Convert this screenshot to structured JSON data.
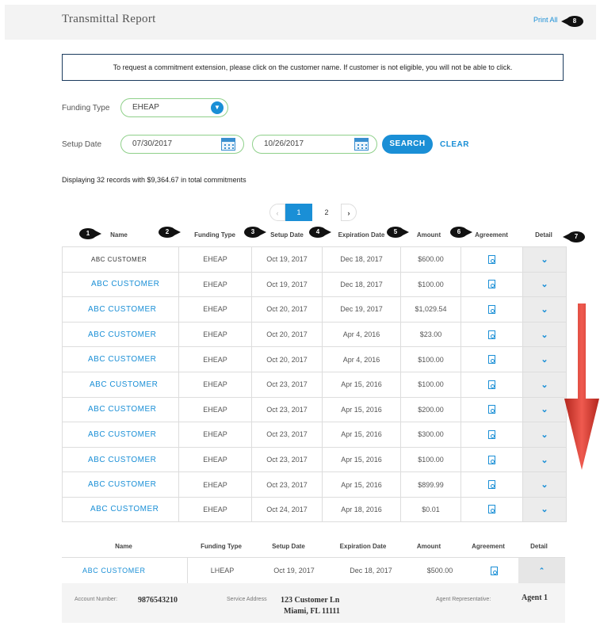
{
  "header": {
    "title": "Transmittal Report",
    "print_all": "Print All"
  },
  "callouts": {
    "c1": "1",
    "c2": "2",
    "c3": "3",
    "c4": "4",
    "c5": "5",
    "c6": "6",
    "c7": "7",
    "c8": "8"
  },
  "info_text": "To request a commitment extension, please click on the customer name. If customer is not eligible, you will not be able to click.",
  "filters": {
    "funding_type_label": "Funding Type",
    "funding_type_value": "EHEAP",
    "setup_date_label": "Setup Date",
    "start_date": "07/30/2017",
    "end_date": "10/26/2017",
    "search_label": "SEARCH",
    "clear_label": "CLEAR"
  },
  "records_text": "Displaying 32 records with $9,364.67 in total commitments",
  "pager": {
    "prev": "‹",
    "page1": "1",
    "page2": "2",
    "next": "›"
  },
  "columns": {
    "name": "Name",
    "funding": "Funding Type",
    "setup": "Setup Date",
    "expiration": "Expiration Date",
    "amount": "Amount",
    "agreement": "Agreement",
    "detail": "Detail"
  },
  "rows": [
    {
      "name": "ABC CUSTOMER",
      "funding": "EHEAP",
      "setup": "Oct 19, 2017",
      "expiration": "Dec 18, 2017",
      "amount": "$600.00"
    },
    {
      "name": "ABC CUSTOMER",
      "funding": "EHEAP",
      "setup": "Oct 19, 2017",
      "expiration": "Dec 18, 2017",
      "amount": "$100.00"
    },
    {
      "name": "ABC CUSTOMER",
      "funding": "EHEAP",
      "setup": "Oct 20, 2017",
      "expiration": "Dec 19, 2017",
      "amount": "$1,029.54"
    },
    {
      "name": "ABC CUSTOMER",
      "funding": "EHEAP",
      "setup": "Oct 20, 2017",
      "expiration": "Apr 4, 2016",
      "amount": "$23.00"
    },
    {
      "name": "ABC CUSTOMER",
      "funding": "EHEAP",
      "setup": "Oct 20, 2017",
      "expiration": "Apr 4, 2016",
      "amount": "$100.00"
    },
    {
      "name": "ABC CUSTOMER",
      "funding": "EHEAP",
      "setup": "Oct 23, 2017",
      "expiration": "Apr 15, 2016",
      "amount": "$100.00"
    },
    {
      "name": "ABC CUSTOMER",
      "funding": "EHEAP",
      "setup": "Oct 23, 2017",
      "expiration": "Apr 15, 2016",
      "amount": "$200.00"
    },
    {
      "name": "ABC CUSTOMER",
      "funding": "EHEAP",
      "setup": "Oct 23, 2017",
      "expiration": "Apr 15, 2016",
      "amount": "$300.00"
    },
    {
      "name": "ABC CUSTOMER",
      "funding": "EHEAP",
      "setup": "Oct 23, 2017",
      "expiration": "Apr 15, 2016",
      "amount": "$100.00"
    },
    {
      "name": "ABC CUSTOMER",
      "funding": "EHEAP",
      "setup": "Oct 23, 2017",
      "expiration": "Apr 15, 2016",
      "amount": "$899.99"
    },
    {
      "name": "ABC CUSTOMER",
      "funding": "EHEAP",
      "setup": "Oct 24, 2017",
      "expiration": "Apr 18, 2016",
      "amount": "$0.01"
    }
  ],
  "expanded_row": {
    "name": "ABC CUSTOMER",
    "funding": "LHEAP",
    "setup": "Oct 19, 2017",
    "expiration": "Dec 18, 2017",
    "amount": "$500.00"
  },
  "details": {
    "account_label": "Account Number:",
    "account_value": "9876543210",
    "address_label": "Service Address",
    "address_line1": "123 Customer Ln",
    "address_line2": "Miami, FL 11111",
    "agent_label": "Agent Representative:",
    "agent_value": "Agent 1"
  },
  "icons": {
    "dropdown": "chevron-down-icon",
    "calendar": "calendar-icon",
    "pdf": "pdf-icon",
    "detail": "chevron-icon",
    "arrow": "scroll-down-arrow"
  },
  "colors": {
    "accent": "#1a8fd6",
    "pill_border": "#8fd08a",
    "arrow": "#e2453c"
  }
}
